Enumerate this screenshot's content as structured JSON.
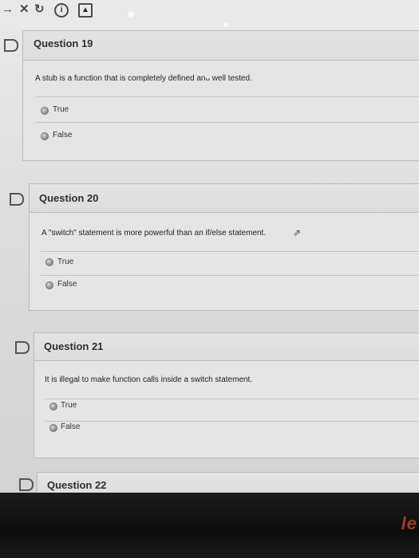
{
  "toolbar": {
    "icons": [
      "forward-arrow-icon",
      "close-icon",
      "reload-icon",
      "info-icon",
      "document-icon"
    ]
  },
  "questions": [
    {
      "title": "Question 19",
      "text": "A stub is a function that is completely defined anᴗ well tested.",
      "options": [
        "True",
        "False"
      ]
    },
    {
      "title": "Question 20",
      "text": "A \"switch\" statement is more powerful than an if/else statement.",
      "options": [
        "True",
        "False"
      ]
    },
    {
      "title": "Question 21",
      "text": "It is illegal to make function calls inside a switch statement.",
      "options": [
        "True",
        "False"
      ]
    },
    {
      "title": "Question 22"
    }
  ],
  "brand": "le",
  "colors": {
    "card_bg": "#e4e6e5",
    "card_border": "#b9bbba",
    "bezel": "#111111",
    "brand": "#a03a25"
  }
}
